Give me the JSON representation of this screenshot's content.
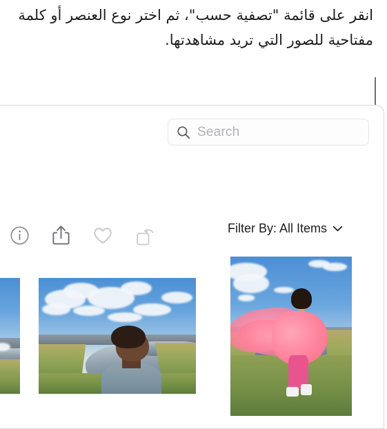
{
  "caption": {
    "text": "انقر على قائمة \"تصفية حسب\"، ثم اختر نوع العنصر أو كلمة مفتاحية للصور التي تريد مشاهدتها.",
    "language": "ar",
    "direction": "rtl"
  },
  "callout": {
    "name": "callout-bracket",
    "color": "#6e6e73",
    "points_to": "filter-by-control"
  },
  "window": {
    "name": "photos-app-window",
    "background": "#ffffff",
    "border_color": "#d8d8d8"
  },
  "toolbar": {
    "items": [
      {
        "id": "info",
        "icon": "info-circle-icon",
        "label": "Info",
        "state": "enabled",
        "color": "#8a8a8e"
      },
      {
        "id": "share",
        "icon": "share-icon",
        "label": "Share",
        "state": "enabled",
        "color": "#6e6e73"
      },
      {
        "id": "favorite",
        "icon": "heart-icon",
        "label": "Favorite",
        "state": "disabled",
        "color": "#c9c9cc"
      },
      {
        "id": "rotate",
        "icon": "rotate-icon",
        "label": "Rotate",
        "state": "disabled",
        "color": "#cdcdd0"
      }
    ]
  },
  "search": {
    "name": "search-field",
    "placeholder": "Search",
    "value": "",
    "icon": "search-icon",
    "border_color": "#e6e6e6",
    "placeholder_color": "#b0b0b4"
  },
  "filter": {
    "name": "filter-by-control",
    "label": "Filter By: All Items",
    "label_prefix": "Filter By:",
    "selected_value": "All Items",
    "chevron_icon": "chevron-down-icon",
    "options": [
      "All Items"
    ]
  },
  "photo_grid": {
    "name": "photo-grid",
    "photos": [
      {
        "id": "photo-partial",
        "alt": "Landscape with river and grassy meadow under blue sky, partially visible at left edge",
        "orientation": "cropped"
      },
      {
        "id": "photo-center",
        "alt": "Person with short dark hair looking upward in a grassy meadow beside a winding river with mountains and clouds",
        "orientation": "landscape"
      },
      {
        "id": "photo-right",
        "alt": "Person in a flowing pink dress standing in a grassy meadow under a blue sky with clouds",
        "orientation": "portrait"
      }
    ]
  },
  "colors": {
    "text_primary": "#1d1d1f",
    "text_placeholder": "#b0b0b4",
    "icon_enabled": "#6e6e73",
    "icon_disabled": "#c9c9cc",
    "callout_line": "#6e6e73",
    "panel_border": "#d8d8d8",
    "background": "#ffffff"
  }
}
